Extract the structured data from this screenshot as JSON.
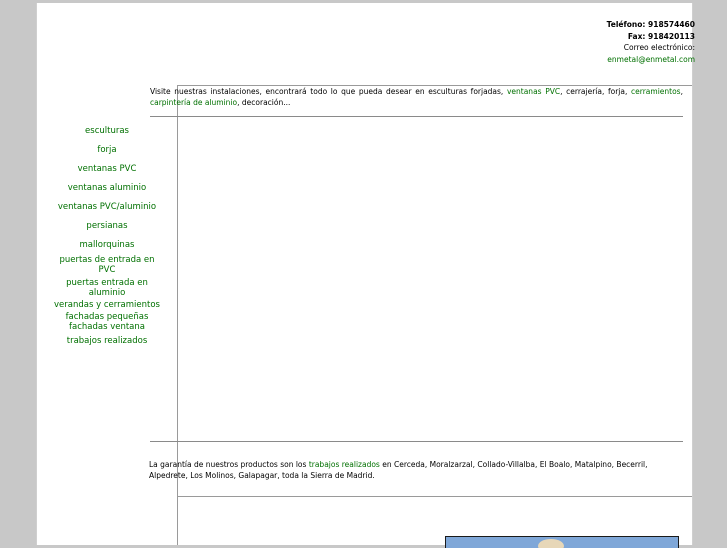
{
  "contact": {
    "phone": "Teléfono: 918574460",
    "fax": "Fax: 918420113",
    "email_label": "Correo electrónico:",
    "email": "enmetal@enmetal.com"
  },
  "nav": {
    "items": [
      "esculturas",
      "forja",
      "ventanas PVC",
      "ventanas aluminio",
      "ventanas PVC/aluminio",
      "persianas",
      "mallorquinas",
      "puertas de entrada en",
      "PVC",
      "puertas entrada en",
      "aluminio",
      "verandas y cerramientos",
      "fachadas pequeñas",
      "fachadas ventana",
      "trabajos realizados"
    ]
  },
  "intro": {
    "text_1": "Visite nuestras instalaciones, encontrará todo lo que pueda desear en esculturas forjadas, ",
    "link_1": "ventanas PVC",
    "text_2": ", cerrajería, forja, ",
    "link_2": "cerramientos",
    "text_3": ", ",
    "link_3": "carpintería de aluminio",
    "text_4": ", decoración..."
  },
  "guarantee": {
    "text_1": "La garantía de nuestros productos son los ",
    "link": "trabajos realizados",
    "text_2": " en Cerceda, Moralzarzal, Collado-Villalba, El Boalo, Matalpino, Becerril, Alpedrete, Los Molinos, Galapagar, toda la Sierra de Madrid."
  },
  "colors": {
    "link_green": "#007000",
    "page_bg": "#ffffff",
    "outer_bg": "#c8c8c8"
  }
}
